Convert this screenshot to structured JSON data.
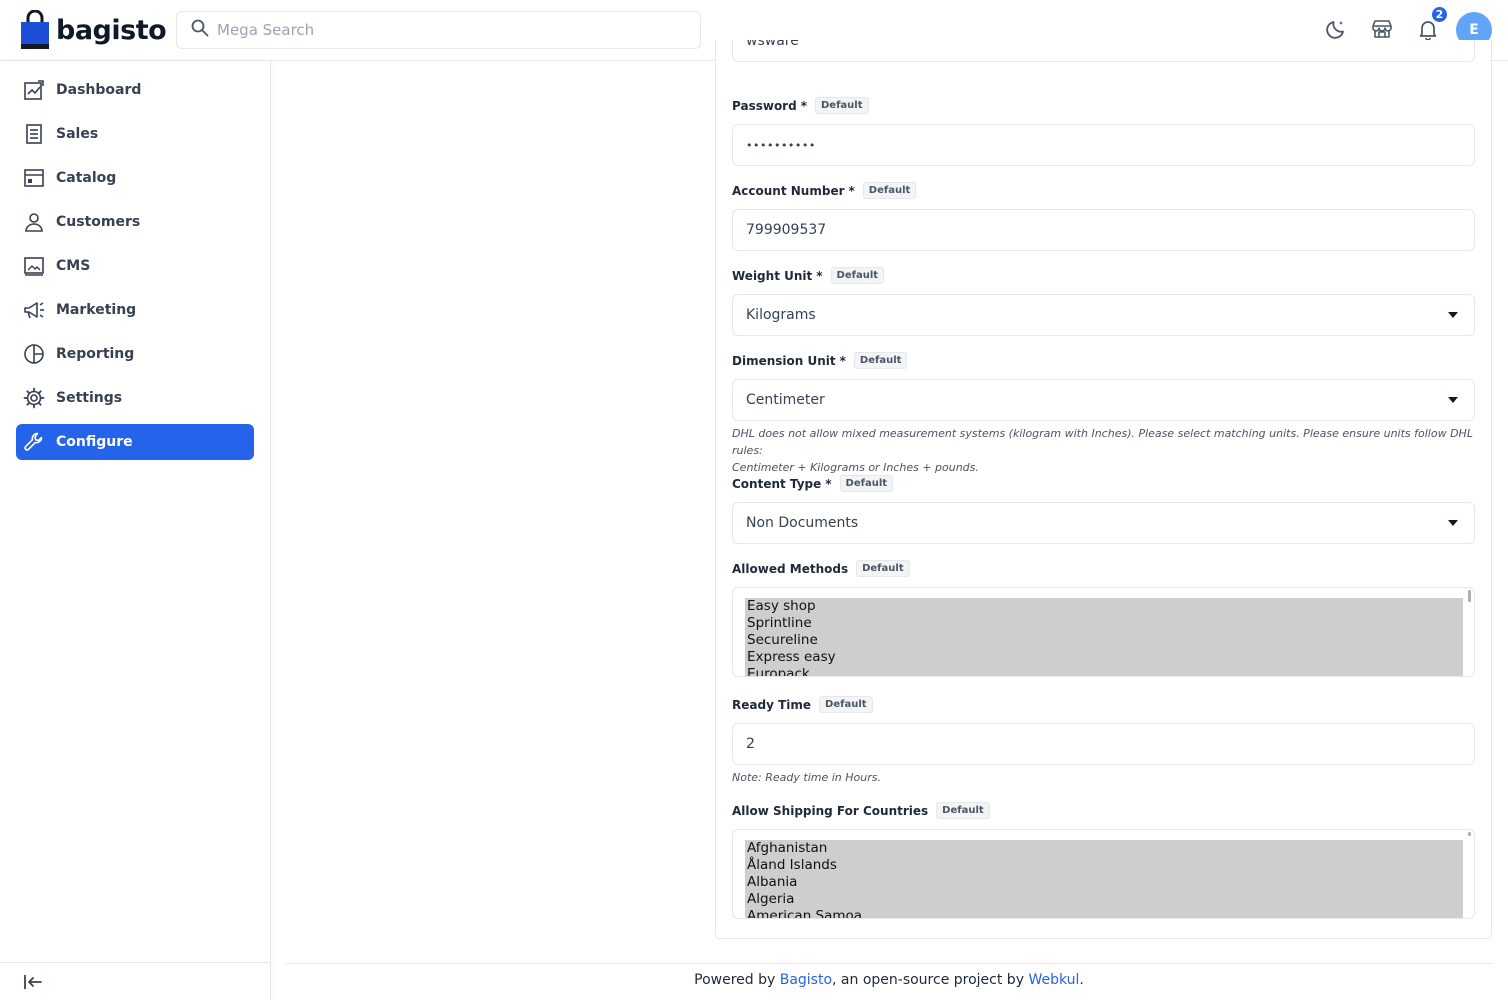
{
  "app": {
    "name": "bagisto",
    "brand_color": "#2563eb"
  },
  "header": {
    "search_placeholder": "Mega Search",
    "notification_count": "2",
    "avatar_initial": "E"
  },
  "sidebar": {
    "items": [
      {
        "label": "Dashboard",
        "icon": "dashboard-icon"
      },
      {
        "label": "Sales",
        "icon": "sales-icon"
      },
      {
        "label": "Catalog",
        "icon": "catalog-icon"
      },
      {
        "label": "Customers",
        "icon": "customers-icon"
      },
      {
        "label": "CMS",
        "icon": "cms-icon"
      },
      {
        "label": "Marketing",
        "icon": "marketing-icon"
      },
      {
        "label": "Reporting",
        "icon": "reporting-icon"
      },
      {
        "label": "Settings",
        "icon": "settings-icon"
      },
      {
        "label": "Configure",
        "icon": "configure-icon",
        "active": true
      }
    ]
  },
  "form": {
    "default_tag": "Default",
    "required_mark": "*",
    "prev_field_value": "wsware",
    "password": {
      "label": "Password",
      "value": "••••••••••"
    },
    "account_number": {
      "label": "Account Number",
      "value": "799909537"
    },
    "weight_unit": {
      "label": "Weight Unit",
      "value": "Kilograms"
    },
    "dimension_unit": {
      "label": "Dimension Unit",
      "value": "Centimeter",
      "note_line1": "DHL does not allow mixed measurement systems (kilogram with Inches). Please select matching units. Please ensure units follow DHL rules:",
      "note_line2": "Centimeter + Kilograms or Inches + pounds."
    },
    "content_type": {
      "label": "Content Type",
      "value": "Non Documents"
    },
    "allowed_methods": {
      "label": "Allowed Methods",
      "options": [
        "Easy shop",
        "Sprintline",
        "Secureline",
        "Express easy",
        "Europack"
      ]
    },
    "ready_time": {
      "label": "Ready Time",
      "value": "2",
      "note": "Note: Ready time in Hours."
    },
    "allow_countries": {
      "label": "Allow Shipping For Countries",
      "options": [
        "Afghanistan",
        "Åland Islands",
        "Albania",
        "Algeria",
        "American Samoa"
      ]
    }
  },
  "footer": {
    "prefix": "Powered by ",
    "link1": "Bagisto",
    "middle": ", an open-source project by ",
    "link2": "Webkul",
    "suffix": "."
  }
}
